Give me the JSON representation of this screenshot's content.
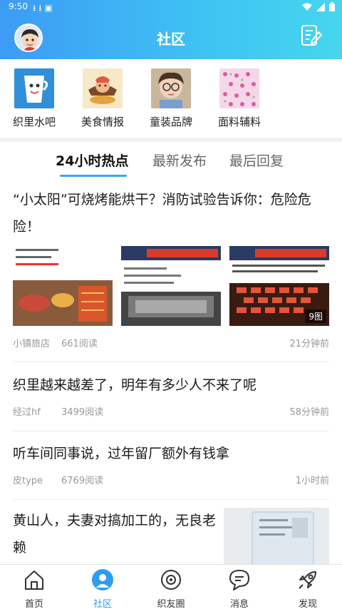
{
  "status_bar": {
    "time": "9:50"
  },
  "header": {
    "title": "社区"
  },
  "categories": [
    {
      "label": "织里水吧"
    },
    {
      "label": "美食情报"
    },
    {
      "label": "童装品牌"
    },
    {
      "label": "面料辅料"
    }
  ],
  "tabs": [
    {
      "label": "24小时热点"
    },
    {
      "label": "最新发布"
    },
    {
      "label": "最后回复"
    }
  ],
  "posts": [
    {
      "title": "“小太阳”可烧烤能烘干？消防试验告诉你：危险危险！",
      "author": "小镇旅店",
      "reads": "661阅读",
      "time": "21分钟前",
      "image_count": "9图"
    },
    {
      "title": "织里越来越差了，明年有多少人不来了呢",
      "author": "经过hf",
      "reads": "3499阅读",
      "time": "58分钟前"
    },
    {
      "title": "听车间同事说，过年留厂额外有钱拿",
      "author": "皮type",
      "reads": "6769阅读",
      "time": "1小时前"
    },
    {
      "title": "黄山人，夫妻对搞加工的，无良老赖"
    }
  ],
  "bottom_nav": [
    {
      "label": "首页"
    },
    {
      "label": "社区"
    },
    {
      "label": "织友圈"
    },
    {
      "label": "消息"
    },
    {
      "label": "发现"
    }
  ],
  "colors": {
    "accent": "#2c9df0",
    "header_start": "#3d9bf5",
    "header_end": "#46d6ee"
  }
}
